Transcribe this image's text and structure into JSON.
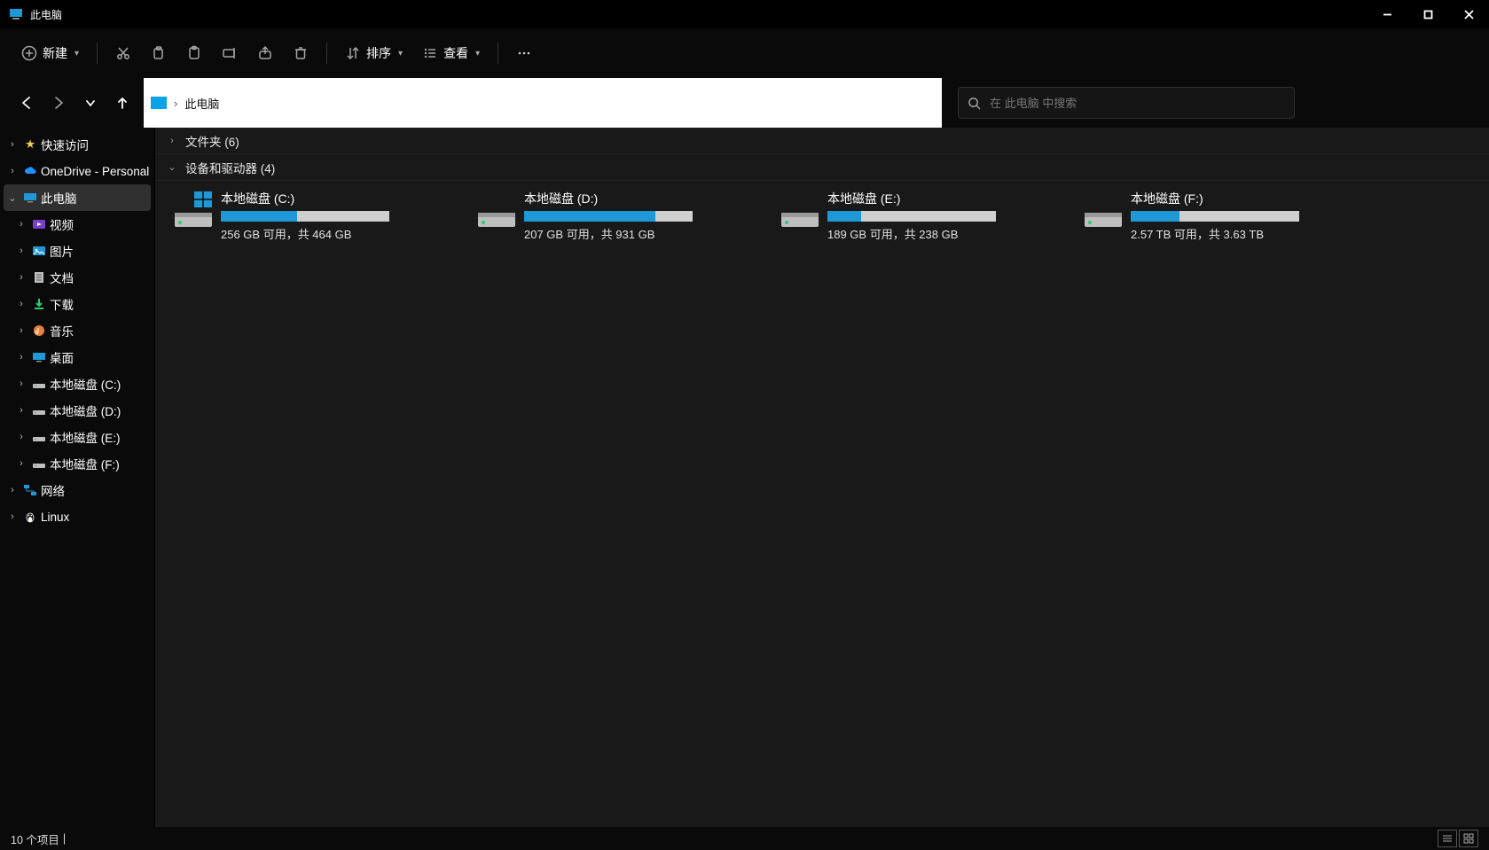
{
  "window": {
    "title": "此电脑"
  },
  "toolbar": {
    "new_label": "新建",
    "sort_label": "排序",
    "view_label": "查看"
  },
  "address": {
    "crumb": "此电脑"
  },
  "search": {
    "placeholder": "在 此电脑 中搜索"
  },
  "sidebar": {
    "quick_access": "快速访问",
    "onedrive": "OneDrive - Personal",
    "this_pc": "此电脑",
    "children": [
      {
        "label": "视频"
      },
      {
        "label": "图片"
      },
      {
        "label": "文档"
      },
      {
        "label": "下载"
      },
      {
        "label": "音乐"
      },
      {
        "label": "桌面"
      },
      {
        "label": "本地磁盘 (C:)"
      },
      {
        "label": "本地磁盘 (D:)"
      },
      {
        "label": "本地磁盘 (E:)"
      },
      {
        "label": "本地磁盘 (F:)"
      }
    ],
    "network": "网络",
    "linux": "Linux"
  },
  "groups": {
    "folders": "文件夹 (6)",
    "devices": "设备和驱动器 (4)"
  },
  "drives": [
    {
      "name": "本地磁盘 (C:)",
      "stats": "256 GB 可用，共 464 GB",
      "used_pct": 45,
      "system": true
    },
    {
      "name": "本地磁盘 (D:)",
      "stats": "207 GB 可用，共 931 GB",
      "used_pct": 78,
      "system": false
    },
    {
      "name": "本地磁盘 (E:)",
      "stats": "189 GB 可用，共 238 GB",
      "used_pct": 20,
      "system": false
    },
    {
      "name": "本地磁盘 (F:)",
      "stats": "2.57 TB 可用，共 3.63 TB",
      "used_pct": 29,
      "system": false
    }
  ],
  "status": {
    "items": "10 个项目"
  }
}
